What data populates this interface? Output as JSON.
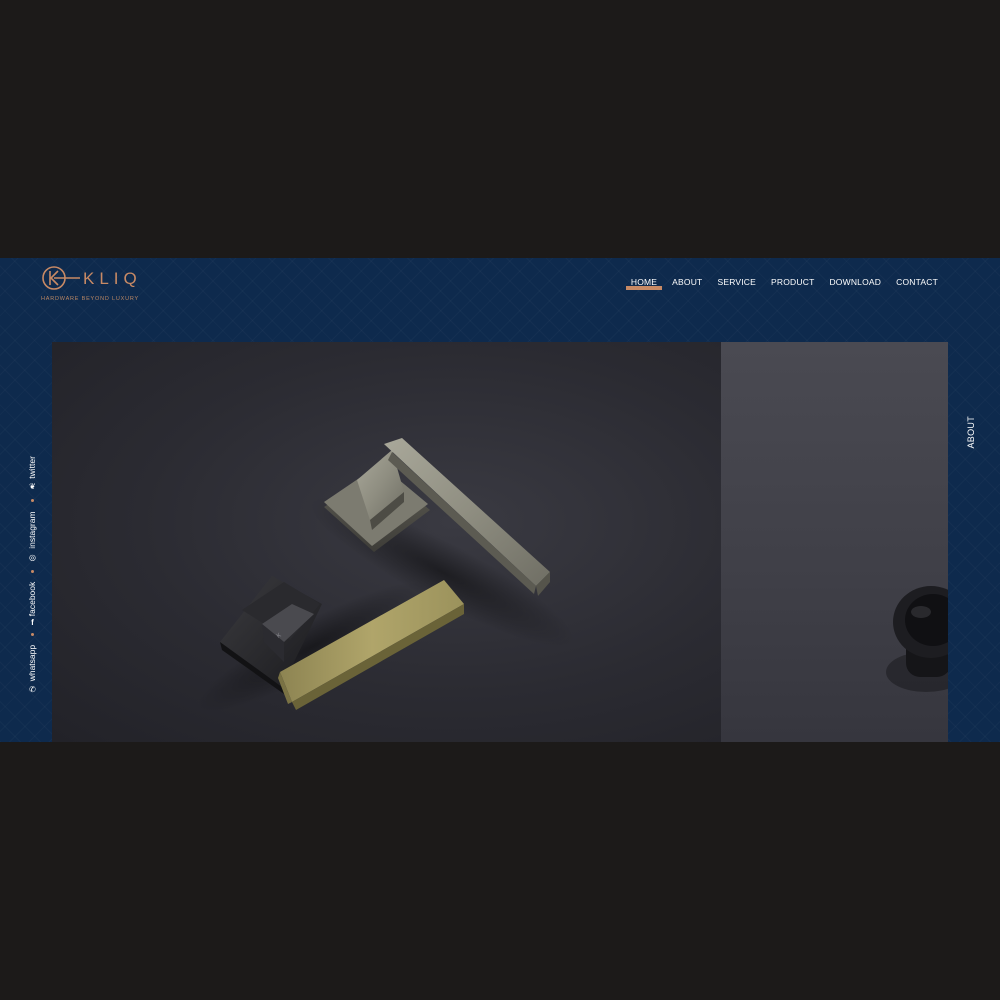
{
  "brand": {
    "name": "KLIQ",
    "tagline": "HARDWARE BEYOND LUXURY",
    "logo_icon": "k-circle-logo-icon",
    "accent_color": "#c88a65",
    "background_color": "#0e2a4d"
  },
  "nav": {
    "items": [
      {
        "label": "HOME",
        "active": true
      },
      {
        "label": "ABOUT",
        "active": false
      },
      {
        "label": "SERVICE",
        "active": false
      },
      {
        "label": "PRODUCT",
        "active": false
      },
      {
        "label": "DOWNLOAD",
        "active": false
      },
      {
        "label": "CONTACT",
        "active": false
      }
    ]
  },
  "social": {
    "items": [
      {
        "label": "whatsapp",
        "icon": "whatsapp-icon"
      },
      {
        "label": "facebook",
        "icon": "facebook-icon"
      },
      {
        "label": "instagram",
        "icon": "instagram-icon"
      },
      {
        "label": "twitter",
        "icon": "twitter-icon"
      }
    ]
  },
  "slider": {
    "side_label": "ABOUT",
    "current_slide_subject": "door-lever-handles-image",
    "next_slide_subject": "round-knob-image"
  }
}
